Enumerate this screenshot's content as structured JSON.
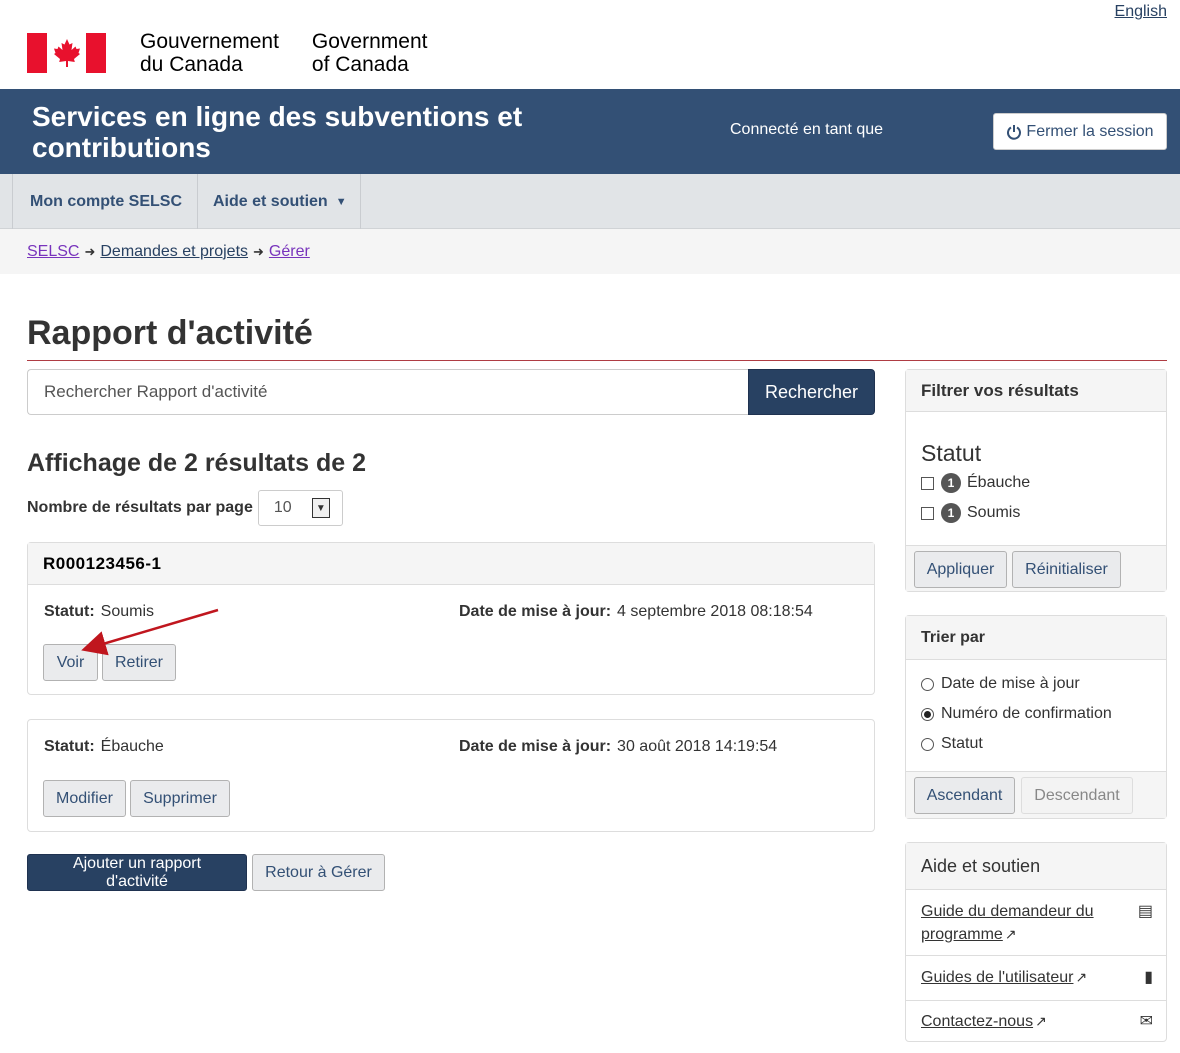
{
  "header": {
    "language_link": "English",
    "signature_fr_line1": "Gouvernement",
    "signature_fr_line2": "du Canada",
    "signature_en_line1": "Government",
    "signature_en_line2": "of Canada"
  },
  "app_banner": {
    "title": "Services en ligne des subventions et contributions",
    "signed_in_label": "Connecté en tant que",
    "logout_label": "Fermer la session"
  },
  "menu": {
    "items": [
      {
        "label": "Mon compte SELSC"
      },
      {
        "label": "Aide et soutien"
      }
    ]
  },
  "breadcrumb": [
    "SELSC",
    "Demandes et projets",
    "Gérer"
  ],
  "page": {
    "title": "Rapport d'activité",
    "search_placeholder": "Rechercher Rapport d'activité",
    "search_button": "Rechercher",
    "results_heading": "Affichage de 2 résultats de 2",
    "per_page_label": "Nombre de résultats par page",
    "per_page_value": "10"
  },
  "results": [
    {
      "id": "R000123456-1",
      "status_label": "Statut:",
      "status": "Soumis",
      "date_label": "Date de mise à jour:",
      "date": "4 septembre 2018 08:18:54",
      "actions": [
        "Voir",
        "Retirer"
      ]
    },
    {
      "status_label": "Statut:",
      "status": "Ébauche",
      "date_label": "Date de mise à jour:",
      "date": "30 août 2018 14:19:54",
      "actions": [
        "Modifier",
        "Supprimer"
      ]
    }
  ],
  "bottom_actions": {
    "add": "Ajouter un rapport d'activité",
    "back": "Retour à Gérer"
  },
  "filter": {
    "heading": "Filtrer vos résultats",
    "group_title": "Statut",
    "options": [
      {
        "count": "1",
        "label": "Ébauche",
        "checked": false
      },
      {
        "count": "1",
        "label": "Soumis",
        "checked": false
      }
    ],
    "apply": "Appliquer",
    "reset": "Réinitialiser"
  },
  "sort": {
    "heading": "Trier par",
    "options": [
      {
        "label": "Date de mise à jour",
        "selected": false
      },
      {
        "label": "Numéro de confirmation",
        "selected": true
      },
      {
        "label": "Statut",
        "selected": false
      }
    ],
    "ascending": "Ascendant",
    "descending": "Descendant"
  },
  "help": {
    "heading": "Aide et soutien",
    "links": [
      {
        "label": "Guide du demandeur du programme",
        "icon": "list-document-icon"
      },
      {
        "label": "Guides de l'utilisateur",
        "icon": "book-icon"
      },
      {
        "label": "Contactez-nous",
        "icon": "envelope-icon"
      }
    ]
  },
  "colors": {
    "banner": "#335075",
    "primary_button": "#284162",
    "flag_red": "#e8112d",
    "title_rule": "#af3c43",
    "annotation_arrow": "#c0161e"
  }
}
